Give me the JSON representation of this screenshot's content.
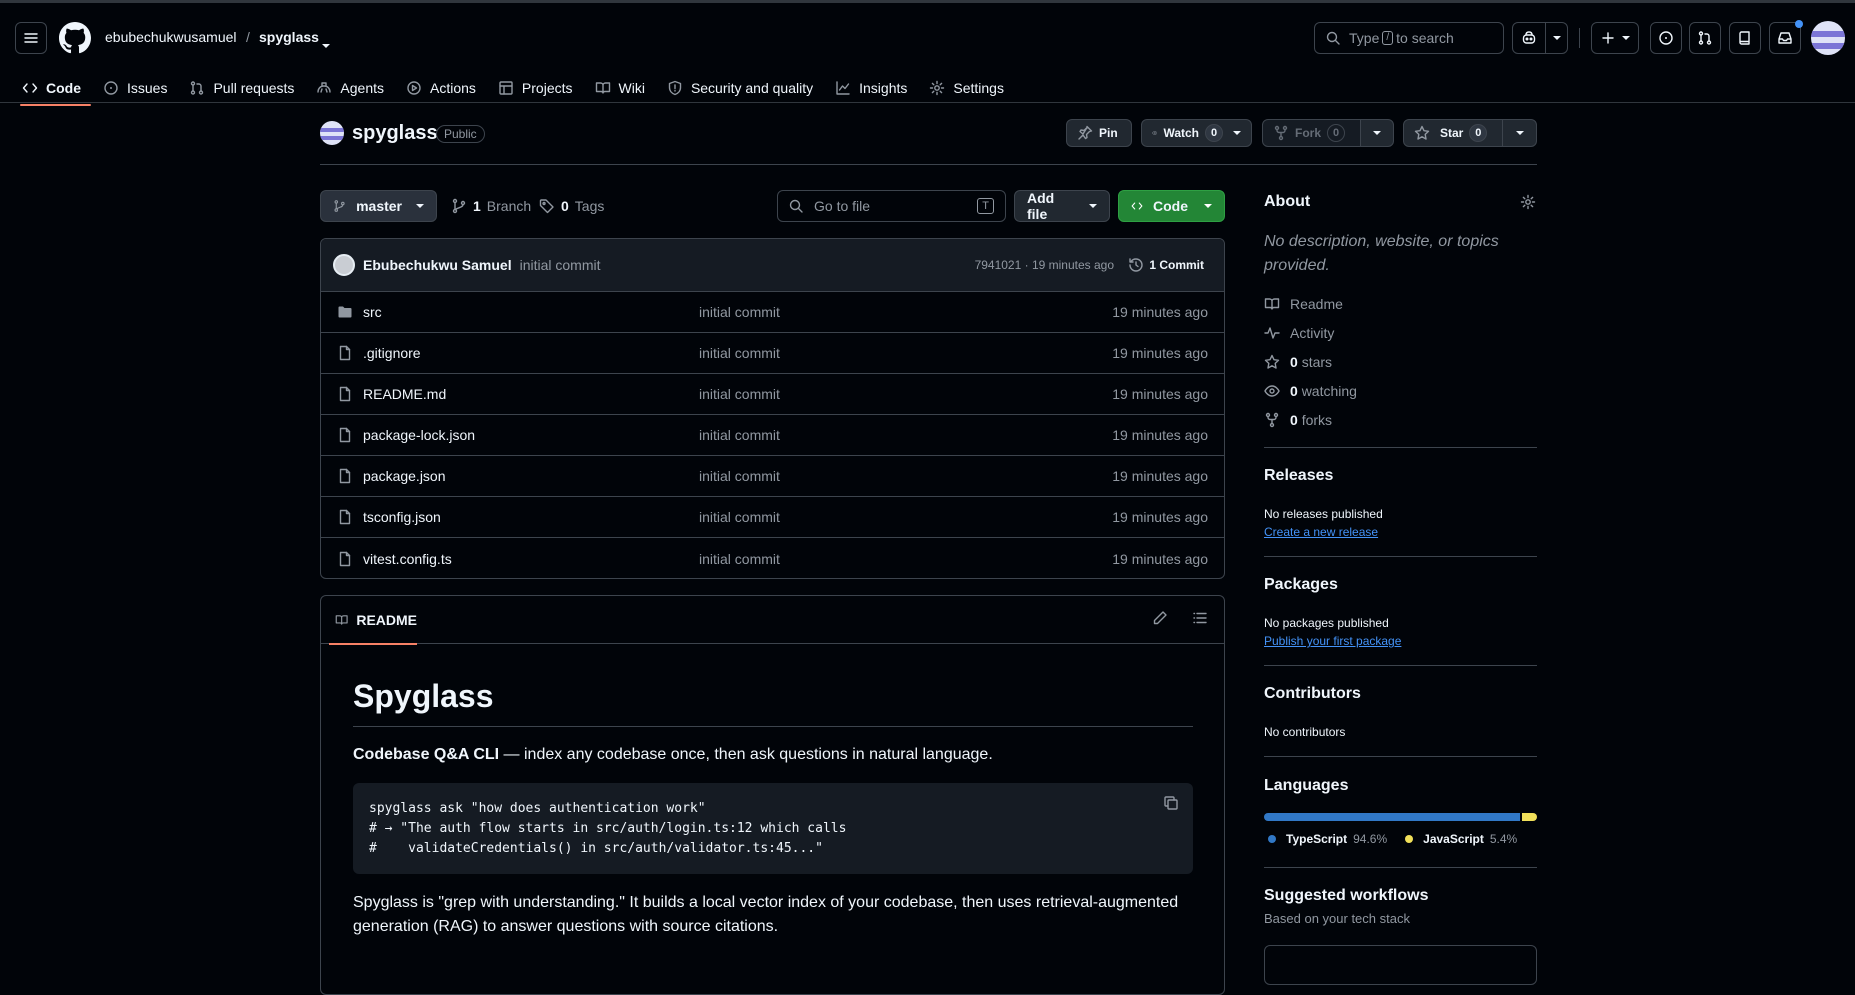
{
  "header": {
    "owner": "ebubechukwusamuel",
    "separator": "/",
    "repo": "spyglass",
    "search_prefix": "Type",
    "search_key": "/",
    "search_suffix": "to search"
  },
  "nav": [
    {
      "label": "Code",
      "icon": "code-icon"
    },
    {
      "label": "Issues",
      "icon": "issue-icon"
    },
    {
      "label": "Pull requests",
      "icon": "pull-request-icon"
    },
    {
      "label": "Agents",
      "icon": "agent-icon"
    },
    {
      "label": "Actions",
      "icon": "play-icon"
    },
    {
      "label": "Projects",
      "icon": "table-icon"
    },
    {
      "label": "Wiki",
      "icon": "book-icon"
    },
    {
      "label": "Security and quality",
      "icon": "shield-icon"
    },
    {
      "label": "Insights",
      "icon": "graph-icon"
    },
    {
      "label": "Settings",
      "icon": "gear-icon"
    }
  ],
  "repo_header": {
    "name": "spyglass",
    "visibility": "Public",
    "pin": "Pin",
    "watch": "Watch",
    "watch_count": "0",
    "fork": "Fork",
    "fork_count": "0",
    "star": "Star",
    "star_count": "0"
  },
  "toolbar": {
    "branch": "master",
    "branch_count": "1",
    "branch_label": "Branch",
    "tag_count": "0",
    "tag_label": "Tags",
    "goto_placeholder": "Go to file",
    "goto_key": "T",
    "add_file": "Add file",
    "code": "Code"
  },
  "commit": {
    "author": "Ebubechukwu Samuel",
    "message": "initial commit",
    "hash_time": "7941021 · 19 minutes ago",
    "count": "1 Commit"
  },
  "files": [
    {
      "name": "src",
      "type": "folder",
      "message": "initial commit",
      "time": "19 minutes ago"
    },
    {
      "name": ".gitignore",
      "type": "file",
      "message": "initial commit",
      "time": "19 minutes ago"
    },
    {
      "name": "README.md",
      "type": "file",
      "message": "initial commit",
      "time": "19 minutes ago"
    },
    {
      "name": "package-lock.json",
      "type": "file",
      "message": "initial commit",
      "time": "19 minutes ago"
    },
    {
      "name": "package.json",
      "type": "file",
      "message": "initial commit",
      "time": "19 minutes ago"
    },
    {
      "name": "tsconfig.json",
      "type": "file",
      "message": "initial commit",
      "time": "19 minutes ago"
    },
    {
      "name": "vitest.config.ts",
      "type": "file",
      "message": "initial commit",
      "time": "19 minutes ago"
    }
  ],
  "readme": {
    "tab": "README",
    "title": "Spyglass",
    "intro_bold": "Codebase Q&A CLI",
    "intro_rest": " — index any codebase once, then ask questions in natural language.",
    "code_lines": [
      "spyglass ask \"how does authentication work\"",
      "# → \"The auth flow starts in src/auth/login.ts:12 which calls",
      "#    validateCredentials() in src/auth/validator.ts:45...\""
    ],
    "para_1": "Spyglass is \"grep with understanding.\" It builds a local vector index of your codebase, then uses retrieval-augmented",
    "para_2": "generation (RAG) to answer questions with source citations."
  },
  "sidebar": {
    "about_title": "About",
    "about_desc_1": "No description, website, or topics",
    "about_desc_2": "provided.",
    "readme": "Readme",
    "activity": "Activity",
    "stars_count": "0",
    "stars_label": "stars",
    "watching_count": "0",
    "watching_label": "watching",
    "forks_count": "0",
    "forks_label": "forks",
    "releases_title": "Releases",
    "releases_text": "No releases published",
    "releases_link": "Create a new release",
    "packages_title": "Packages",
    "packages_text": "No packages published",
    "packages_link": "Publish your first package",
    "contributors_title": "Contributors",
    "contributors_text": "No contributors",
    "languages_title": "Languages",
    "languages": [
      {
        "name": "TypeScript",
        "percent": "94.6%",
        "value": 94.6,
        "color": "#3178c6"
      },
      {
        "name": "JavaScript",
        "percent": "5.4%",
        "value": 5.4,
        "color": "#f1e05a"
      }
    ],
    "workflows_title": "Suggested workflows",
    "workflows_text": "Based on your tech stack"
  },
  "colors": {
    "accent": "#f78166",
    "green": "#238636",
    "link": "#4493f8"
  }
}
